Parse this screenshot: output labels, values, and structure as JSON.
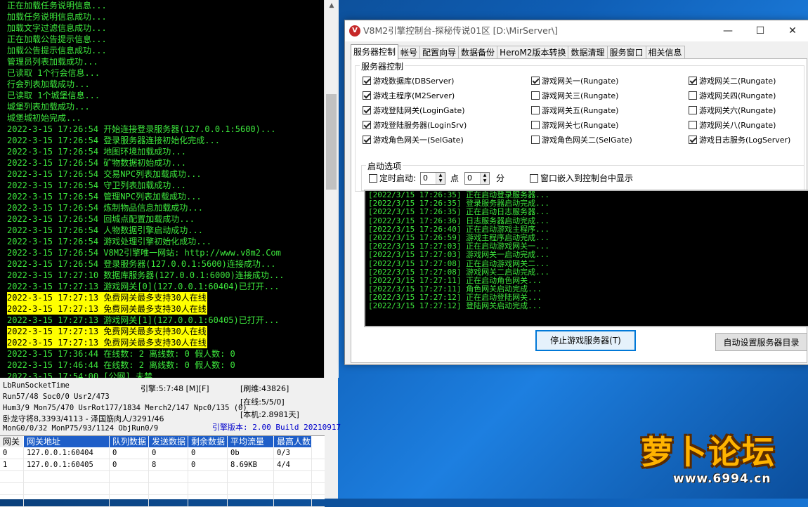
{
  "left_console": {
    "log_lines": [
      {
        "text": "正在加载任务说明信息...",
        "hl": false
      },
      {
        "text": "加载任务说明信息成功...",
        "hl": false
      },
      {
        "text": "加载文字过滤信息成功...",
        "hl": false
      },
      {
        "text": "正在加载公告提示信息...",
        "hl": false
      },
      {
        "text": "加载公告提示信息成功...",
        "hl": false
      },
      {
        "text": "管理员列表加载成功...",
        "hl": false
      },
      {
        "text": "已读取 1个行会信息...",
        "hl": false
      },
      {
        "text": "行会列表加载成功...",
        "hl": false
      },
      {
        "text": "已读取 1个城堡信息...",
        "hl": false
      },
      {
        "text": "城堡列表加载成功...",
        "hl": false
      },
      {
        "text": "城堡城初始完成...",
        "hl": false
      },
      {
        "text": "2022-3-15 17:26:54 开始连接登录服务器(127.0.0.1:5600)...",
        "hl": false
      },
      {
        "text": "2022-3-15 17:26:54 登录服务器连接初始化完成...",
        "hl": false
      },
      {
        "text": "2022-3-15 17:26:54 地图环境加载成功...",
        "hl": false
      },
      {
        "text": "2022-3-15 17:26:54 矿物数据初始成功...",
        "hl": false
      },
      {
        "text": "2022-3-15 17:26:54 交易NPC列表加载成功...",
        "hl": false
      },
      {
        "text": "2022-3-15 17:26:54 守卫列表加载成功...",
        "hl": false
      },
      {
        "text": "2022-3-15 17:26:54 管理NPC列表加载成功...",
        "hl": false
      },
      {
        "text": "2022-3-15 17:26:54 炼制物品信息加载成功...",
        "hl": false
      },
      {
        "text": "2022-3-15 17:26:54 回城点配置加载成功...",
        "hl": false
      },
      {
        "text": "2022-3-15 17:26:54 人物数据引擎启动成功...",
        "hl": false
      },
      {
        "text": "2022-3-15 17:26:54 游戏处理引擎初始化成功...",
        "hl": false
      },
      {
        "text": "2022-3-15 17:26:54 V8M2引擎唯一网站: http://www.v8m2.Com",
        "hl": false
      },
      {
        "text": "2022-3-15 17:26:54 登录服务器(127.0.0.1:5600)连接成功...",
        "hl": false
      },
      {
        "text": "2022-3-15 17:27:10 数据库服务器(127.0.0.1:6000)连接成功...",
        "hl": false
      },
      {
        "text": "2022-3-15 17:27:13 游戏网关[0](127.0.0.1:60404)已打开...",
        "hl": false
      },
      {
        "text": "2022-3-15 17:27:13 免费网关最多支持30人在线",
        "hl": true
      },
      {
        "text": "2022-3-15 17:27:13 免费网关最多支持30人在线",
        "hl": true
      },
      {
        "text": "2022-3-15 17:27:13 游戏网关[1](127.0.0.1:60405)已打开...",
        "hl": false
      },
      {
        "text": "2022-3-15 17:27:13 免费网关最多支持30人在线",
        "hl": true
      },
      {
        "text": "2022-3-15 17:27:13 免费网关最多支持30人在线",
        "hl": true
      },
      {
        "text": "2022-3-15 17:36:44 在线数: 2 离线数: 0 假人数: 0",
        "hl": false
      },
      {
        "text": "2022-3-15 17:46:44 在线数: 2 离线数: 0 假人数: 0",
        "hl": false
      },
      {
        "text": "2022-3-15 17:54:00 [公网] 未禁...",
        "hl": false
      }
    ],
    "stats": {
      "l1": "LbRunSocketTime",
      "l2": "Run57/48 Soc0/0 Usr2/473",
      "l3": "Hum3/9 Mon75/470 UsrRot177/1834 Merch2/147 Npc0/135 (0)",
      "l4": "卧龙守将8,3393/4113 - 泽国筋肉人/3291/46",
      "l5": "MonG0/0/32 MonP75/93/1124 ObjRun0/9",
      "engine": "引擎:5:7:48 [M][F]",
      "refresh": "[刷维:43826]",
      "online": "[在线:5/5/0]",
      "local": "[本机:2.8981天]",
      "version": "引擎版本: 2.00 Build 20210917"
    },
    "table": {
      "headers": [
        "网关",
        "网关地址",
        "队列数据",
        "发送数据",
        "剩余数据",
        "平均流量",
        "最高人数"
      ],
      "rows": [
        [
          "0",
          "127.0.0.1:60404",
          "0",
          "0",
          "0",
          "0b",
          "0/3"
        ],
        [
          "1",
          "127.0.0.1:60405",
          "0",
          "8",
          "0",
          "8.69KB",
          "4/4"
        ]
      ]
    }
  },
  "control_window": {
    "title": "V8M2引擎控制台-探秘传说01区 [D:\\MirServer\\]",
    "tabs": [
      "服务器控制",
      "帐号",
      "配置向导",
      "数据备份",
      "HeroM2版本转换",
      "数据清理",
      "服务窗口",
      "相关信息"
    ],
    "active_tab": "服务器控制",
    "group_title": "服务器控制",
    "checks": [
      {
        "label": "游戏数据库(DBServer)",
        "on": true
      },
      {
        "label": "游戏网关一(Rungate)",
        "on": true
      },
      {
        "label": "游戏网关二(Rungate)",
        "on": true
      },
      {
        "label": "游戏主程序(M2Server)",
        "on": true
      },
      {
        "label": "游戏网关三(Rungate)",
        "on": false
      },
      {
        "label": "游戏网关四(Rungate)",
        "on": false
      },
      {
        "label": "游戏登陆网关(LoginGate)",
        "on": true
      },
      {
        "label": "游戏网关五(Rungate)",
        "on": false
      },
      {
        "label": "游戏网关六(Rungate)",
        "on": false
      },
      {
        "label": "游戏登陆服务器(LoginSrv)",
        "on": true
      },
      {
        "label": "游戏网关七(Rungate)",
        "on": false
      },
      {
        "label": "游戏网关八(Rungate)",
        "on": false
      },
      {
        "label": "游戏角色网关一(SelGate)",
        "on": true
      },
      {
        "label": "游戏角色网关二(SelGate)",
        "on": false
      },
      {
        "label": "游戏日志服务(LogServer)",
        "on": true
      }
    ],
    "startup": {
      "title": "启动选项",
      "timer_label": "定时启动:",
      "hour": "0",
      "hour_unit": "点",
      "minute": "0",
      "minute_unit": "分",
      "embed_label": "窗口嵌入到控制台中显示"
    },
    "log_lines": [
      "[2022/3/15 17:26:35] 正在启动登录服务器...",
      "[2022/3/15 17:26:35] 登录服务器启动完成...",
      "[2022/3/15 17:26:35] 正在启动日志服务器...",
      "[2022/3/15 17:26:36] 日志服务器启动完成...",
      "[2022/3/15 17:26:40] 正在启动游戏主程序...",
      "[2022/3/15 17:26:59] 游戏主程序启动完成...",
      "[2022/3/15 17:27:03] 正在启动游戏网关一...",
      "[2022/3/15 17:27:03] 游戏网关一启动完成...",
      "[2022/3/15 17:27:08] 正在启动游戏网关二...",
      "[2022/3/15 17:27:08] 游戏网关二启动完成...",
      "[2022/3/15 17:27:11] 正在启动角色网关...",
      "[2022/3/15 17:27:11] 角色网关启动完成...",
      "[2022/3/15 17:27:12] 正在启动登陆网关...",
      "[2022/3/15 17:27:12] 登陆网关启动完成..."
    ],
    "stop_button": "停止游戏服务器(T)",
    "auto_dir_button": "自动设置服务器目录"
  },
  "watermark": {
    "text": "萝卜论坛",
    "url": "www.6994.cn"
  }
}
